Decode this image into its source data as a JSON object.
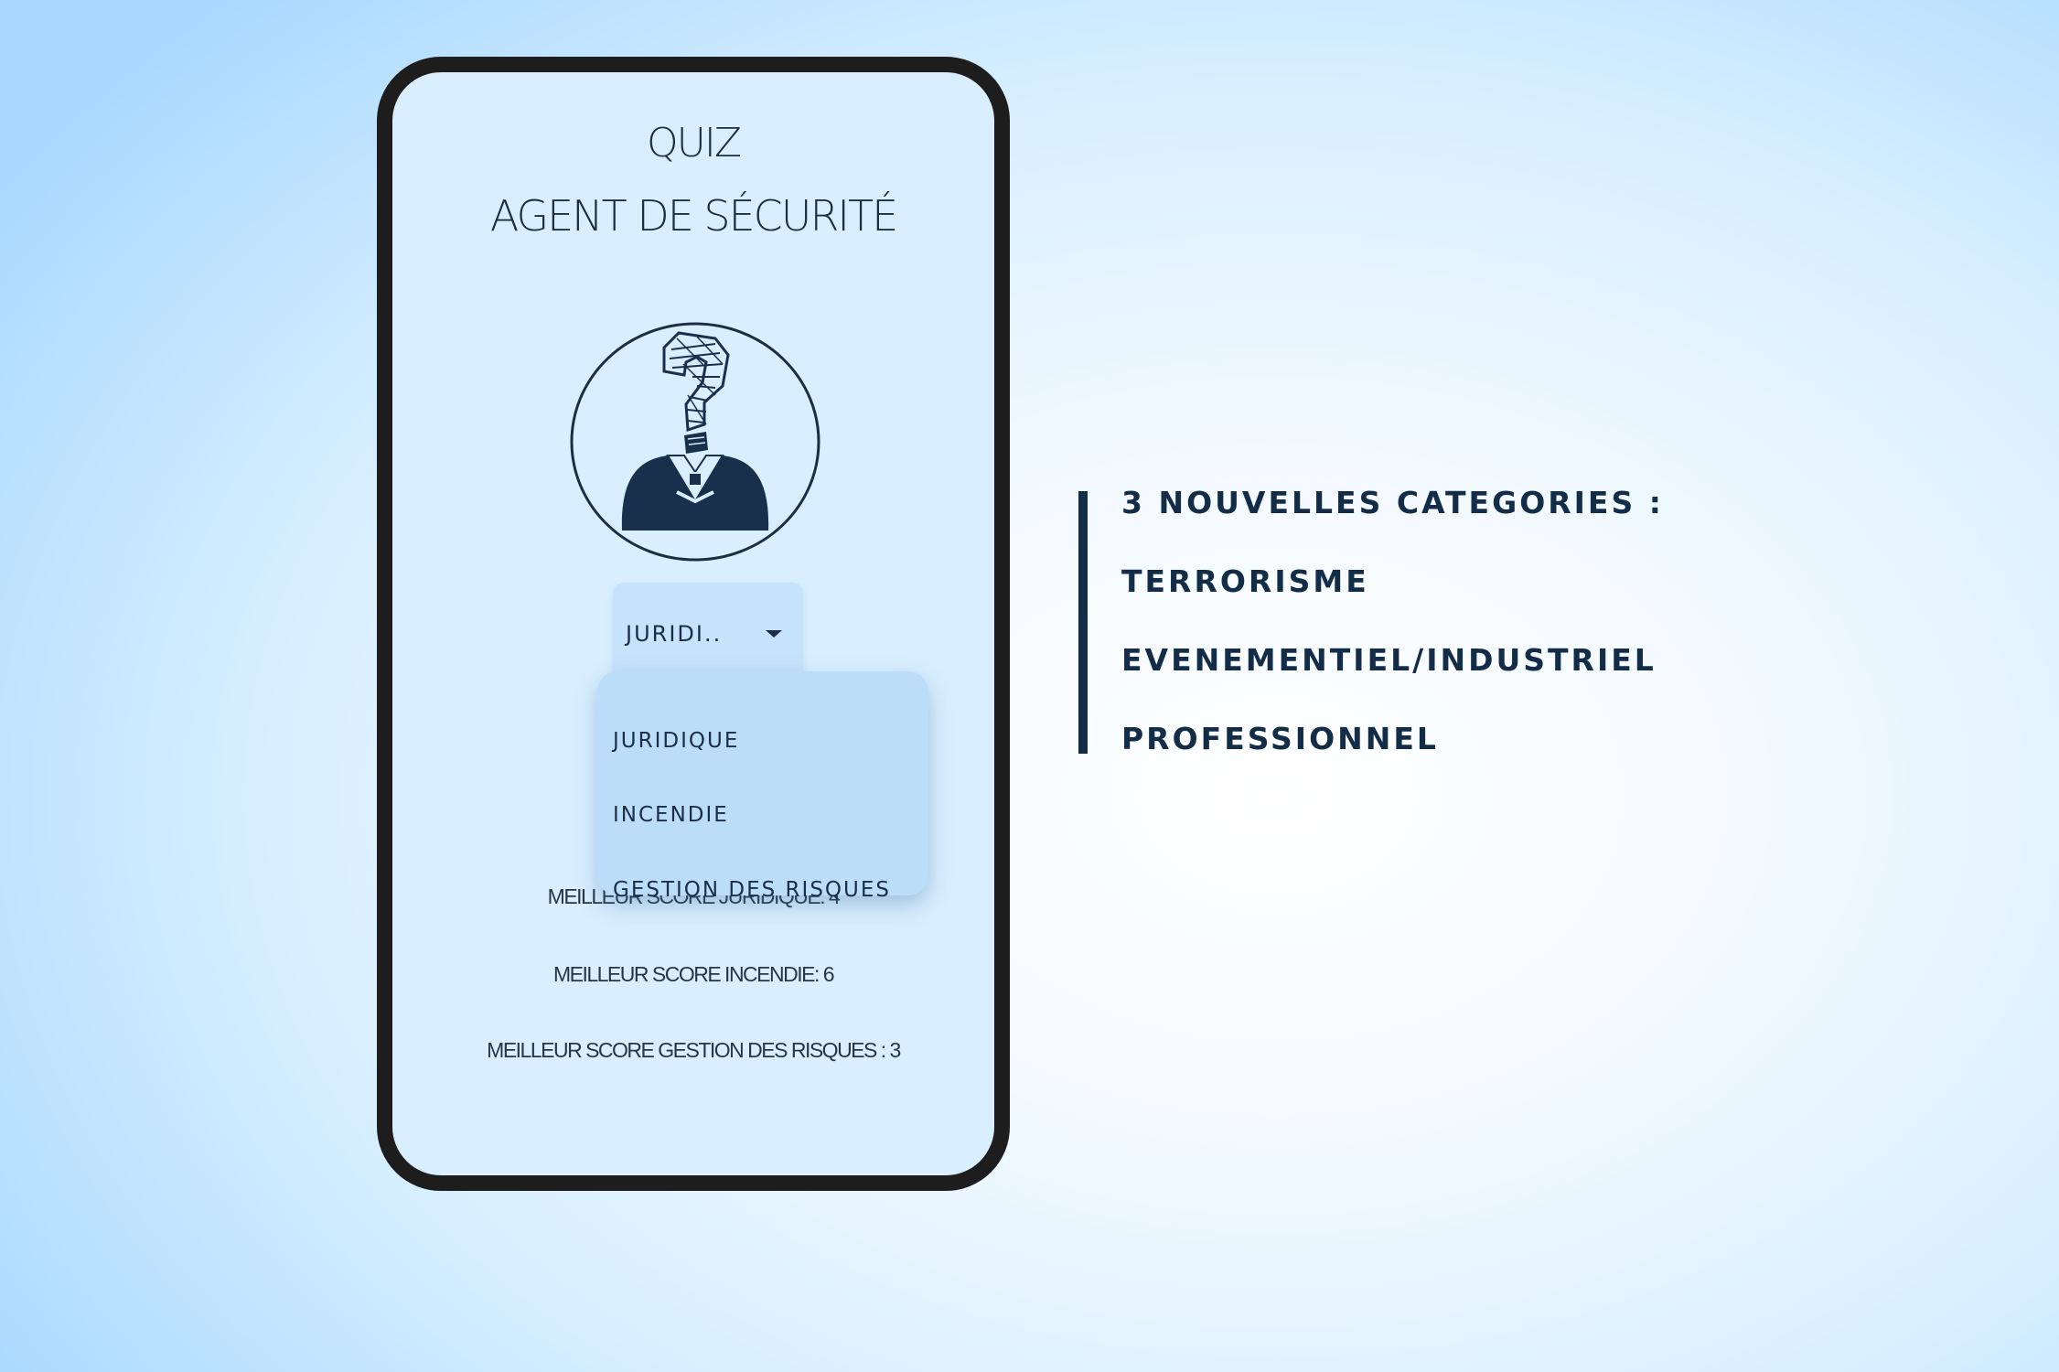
{
  "app": {
    "title_line1": "QUIZ",
    "title_line2": "AGENT DE SÉCURITÉ"
  },
  "avatar": {
    "icon": "security-guard-question-mark-icon"
  },
  "category_select": {
    "selected_value": "JURIDI..",
    "options": [
      "JURIDIQUE",
      "INCENDIE",
      "GESTION DES RISQUES"
    ]
  },
  "scores": [
    "MEILLEUR SCORE JURIDIQUE: 4",
    "MEILLEUR SCORE INCENDIE: 6",
    "MEILLEUR SCORE GESTION DES RISQUES : 3"
  ],
  "features": {
    "heading": "3 NOUVELLES CATEGORIES :",
    "items": [
      "TERRORISME",
      "EVENEMENTIEL/INDUSTRIEL",
      "PROFESSIONNEL"
    ]
  },
  "colors": {
    "accent": "#132c48",
    "phone_screen": "#d9efff",
    "select_bg": "#c7e2fb",
    "menu_bg": "#bcddfa"
  }
}
